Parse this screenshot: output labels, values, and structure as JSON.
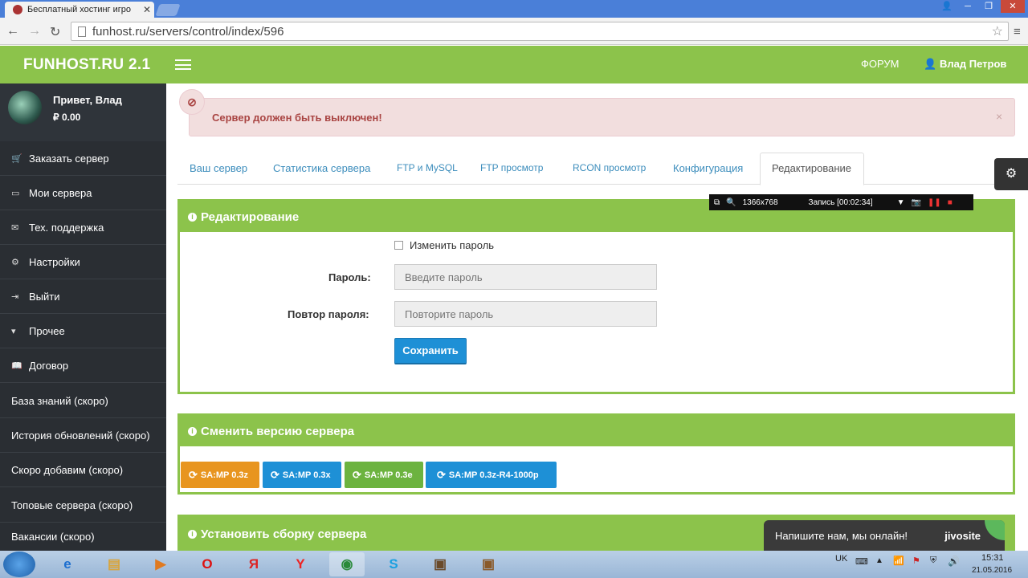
{
  "browser": {
    "tab_title": "Бесплатный хостинг игро",
    "url": "funhost.ru/servers/control/index/596"
  },
  "header": {
    "brand": "FUNHOST.RU 2.1",
    "forum": "ФОРУМ",
    "username": "Влад Петров"
  },
  "profile": {
    "greeting": "Привет, Влад",
    "balance": "₽ 0.00"
  },
  "sidebar": {
    "items": [
      {
        "label": "Заказать сервер",
        "icon": "cart-icon"
      },
      {
        "label": "Мои сервера",
        "icon": "laptop-icon"
      },
      {
        "label": "Тех. поддержка",
        "icon": "envelope-icon"
      },
      {
        "label": "Настройки",
        "icon": "gears-icon"
      },
      {
        "label": "Выйти",
        "icon": "sign-out-icon"
      },
      {
        "label": "Прочее",
        "icon": "caret-down-icon"
      },
      {
        "label": "Договор",
        "icon": "book-icon"
      },
      {
        "label": "База знаний (скоро)"
      },
      {
        "label": "История обновлений (скоро)"
      },
      {
        "label": "Скоро добавим (скоро)"
      },
      {
        "label": "Топовые сервера (скоро)"
      },
      {
        "label": "Вакансии (скоро)"
      }
    ]
  },
  "alert": {
    "text": "Сервер должен быть выключен!",
    "close": "×"
  },
  "tabs": [
    "Ваш сервер",
    "Статистика сервера",
    "FTP и MySQL",
    "FTP просмотр",
    "RCON просмотр",
    "Конфигурация",
    "Редактирование"
  ],
  "active_tab": "Редактирование",
  "recorder": {
    "resolution": "1366x768",
    "status": "Запись [00:02:34]"
  },
  "edit_box": {
    "title": "Редактирование",
    "change_password_label": "Изменить пароль",
    "password_label": "Пароль:",
    "password_placeholder": "Введите пароль",
    "repeat_label": "Повтор пароля:",
    "repeat_placeholder": "Повторите пароль",
    "save": "Сохранить"
  },
  "version_box": {
    "title": "Сменить версию сервера",
    "buttons": [
      {
        "label": "SA:MP 0.3z",
        "color": "#e8951f"
      },
      {
        "label": "SA:MP 0.3x",
        "color": "#1e90d6"
      },
      {
        "label": "SA:MP 0.3e",
        "color": "#6cb33f"
      },
      {
        "label": "SA:MP 0.3z-R4-1000p",
        "color": "#1e90d6"
      }
    ]
  },
  "build_box": {
    "title": "Установить сборку сервера"
  },
  "jivo": {
    "text": "Напишите нам, мы онлайн!",
    "brand": "jivosite"
  },
  "taskbar": {
    "lang": "UK",
    "time": "15:31",
    "date": "21.05.2016"
  },
  "colors": {
    "brand_green": "#8cc34b",
    "sidebar_bg": "#2a2e33",
    "link_blue": "#3c8dbc",
    "alert_red": "#a94442"
  }
}
